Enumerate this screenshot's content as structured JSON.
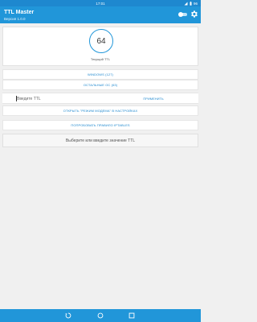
{
  "status_bar": {
    "time": "17:01",
    "signal_icon": "signal-icon",
    "battery_icon": "battery-icon",
    "battery_level": "96"
  },
  "app_bar": {
    "title": "TTL Master",
    "version": "Версия 1.0.0",
    "toggle_state": "on",
    "settings_icon": "gear-icon"
  },
  "ttl_display": {
    "value": "64",
    "caption": "Текущий TTL"
  },
  "buttons": {
    "windows": "WINDOWS (127)",
    "other_os": "ОСТАЛЬНЫЕ ОС (63)",
    "open_modem": "ОТКРЫТЬ \"РЕЖИМ МОДЕМА\" В НАСТРОЙКАХ",
    "try_iptables": "ПОПРОБОВАТЬ ПРАВИЛО IPTABLES"
  },
  "ttl_input": {
    "placeholder": "Введите TTL",
    "value": "",
    "apply_label": "ПРИМЕНИТЬ"
  },
  "message": "Выберите или введите значение TTL",
  "nav_bar": {
    "back_icon": "back-icon",
    "home_icon": "home-icon",
    "recents_icon": "recents-icon"
  },
  "colors": {
    "primary": "#2196d9",
    "status_bar": "#1e88cf",
    "accent_text": "#1e88cf"
  }
}
